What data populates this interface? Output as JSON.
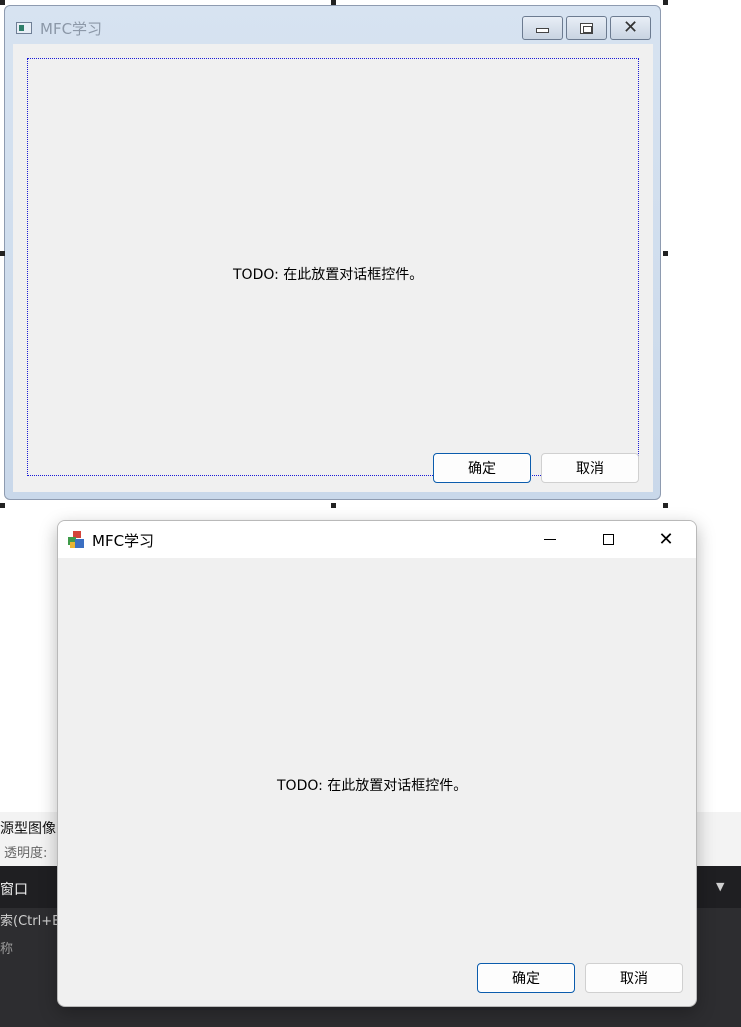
{
  "designer": {
    "title": "MFC学习",
    "todo_text": "TODO: 在此放置对话框控件。",
    "ok_label": "确定",
    "cancel_label": "取消"
  },
  "ide": {
    "prop_label": "源型图像",
    "opacity_label": "透明度:",
    "panel_title": "窗口",
    "search_placeholder": "索(Ctrl+E",
    "column_name": "称"
  },
  "runtime": {
    "title": "MFC学习",
    "todo_text": "TODO: 在此放置对话框控件。",
    "ok_label": "确定",
    "cancel_label": "取消",
    "minimize_glyph": "—",
    "close_glyph": "✕"
  }
}
